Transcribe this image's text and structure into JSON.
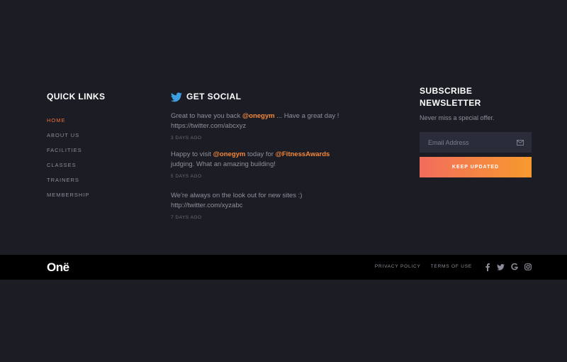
{
  "quick_links": {
    "title": "QUICK LINKS",
    "items": [
      {
        "label": "HOME",
        "active": true
      },
      {
        "label": "ABOUT US"
      },
      {
        "label": "FACILITIES"
      },
      {
        "label": "CLASSES"
      },
      {
        "label": "TRAINERS"
      },
      {
        "label": "MEMBERSHIP"
      }
    ]
  },
  "social": {
    "title": "GET SOCIAL",
    "icon": "twitter-icon",
    "tweets": [
      {
        "parts": [
          "Great to have you back ",
          "@onegym",
          " ... Have a great day !",
          "https://twitter.com/abcxyz"
        ],
        "time": "3 DAYS AGO"
      },
      {
        "parts": [
          "Happy to visit ",
          "@onegym",
          " today for ",
          "@FitnessAwards",
          "judging. What an amazing building!"
        ],
        "time": "5 DAYS AGO"
      },
      {
        "parts": [
          "We're always on the look out for new sites :)",
          "http://twitter.com/xyzabc"
        ],
        "time": "7 DAYS AGO"
      }
    ]
  },
  "newsletter": {
    "title": "SUBSCRIBE NEWSLETTER",
    "text": "Never miss a special offer.",
    "email_placeholder": "Email Address",
    "button": "KEEP UPDATED"
  },
  "bottom": {
    "logo": "Onë",
    "privacy": "PRIVACY POLICY",
    "terms": "TERMS OF USE",
    "socials": [
      "facebook-icon",
      "twitter-icon",
      "google-icon",
      "instagram-icon"
    ]
  },
  "colors": {
    "background": "#1b1c24",
    "accent": "#f26f3c",
    "gradient_start": "#f26d5d",
    "gradient_end": "#f79a2e",
    "twitter_blue": "#3d9fe0"
  }
}
